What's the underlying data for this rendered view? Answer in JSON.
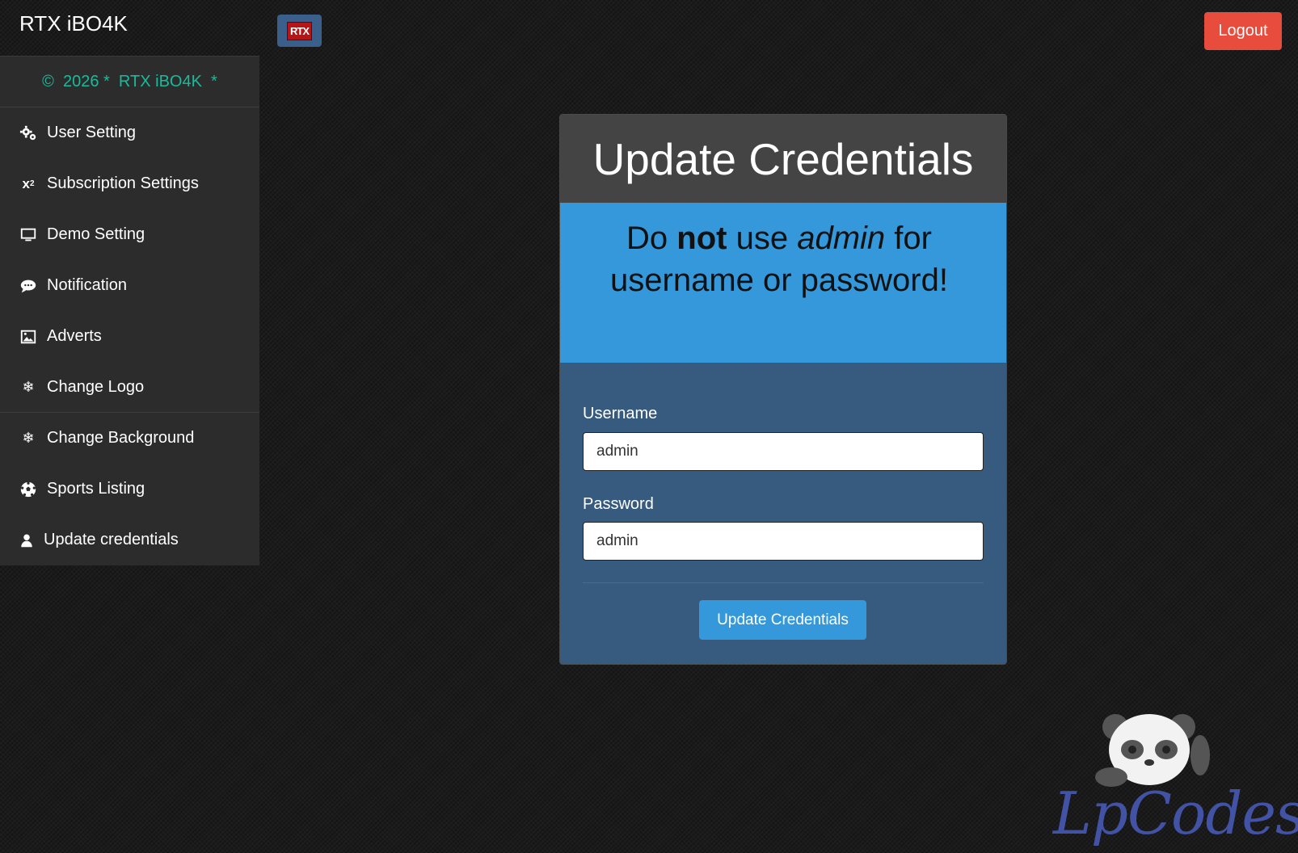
{
  "header": {
    "brand": "RTX iBO4K",
    "logo_text": "RTX",
    "logout_label": "Logout"
  },
  "sidebar": {
    "copyright": "©  2026 *  RTX iBO4K  *",
    "items": [
      {
        "label": "User Setting",
        "icon": "gears-icon"
      },
      {
        "label": "Subscription Settings",
        "icon": "subscript-icon"
      },
      {
        "label": "Demo Setting",
        "icon": "monitor-icon"
      },
      {
        "label": "Notification",
        "icon": "chat-icon"
      },
      {
        "label": "Adverts",
        "icon": "image-icon"
      },
      {
        "label": "Change Logo",
        "icon": "snowflake-icon"
      },
      {
        "label": "Change Background",
        "icon": "snowflake-icon"
      },
      {
        "label": "Sports Listing",
        "icon": "soccer-ball-icon"
      },
      {
        "label": "Update credentials",
        "icon": "user-icon"
      }
    ]
  },
  "card": {
    "title": "Update Credentials",
    "warning": {
      "pre": "Do ",
      "bold": "not",
      "mid": " use ",
      "italic": "admin",
      "post": " for username or password!"
    },
    "username_label": "Username",
    "username_value": "admin",
    "password_label": "Password",
    "password_value": "admin",
    "submit_label": "Update Credentials"
  },
  "watermark": {
    "text": "LpCodes"
  },
  "colors": {
    "accent_green": "#18bc9c",
    "danger": "#e74c3c",
    "info": "#3498db",
    "card_body": "#375a7f"
  }
}
